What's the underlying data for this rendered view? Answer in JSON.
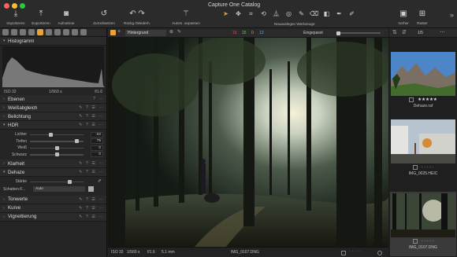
{
  "app": {
    "title": "Capture One Catalog"
  },
  "toolbar": {
    "import": "Importieren",
    "export": "Exportieren",
    "capture": "Aufnahme",
    "reset": "Zurücksetzen",
    "undo_redo": "Rückg./Wiederh.",
    "auto_adjust": "Autom. anpassen",
    "cursor_tools": "Neuauslegen Werkzeuge",
    "viewer": "Vorher",
    "grid": "Raster"
  },
  "histogram": {
    "title": "Histogramm",
    "iso": "ISO 32",
    "shutter": "1/560 s",
    "aperture": "f/1.6"
  },
  "tools": {
    "layers": "Ebenen",
    "white_balance": "Weißabgleich",
    "exposure": "Belichtung",
    "hdr": {
      "title": "HDR",
      "sliders": [
        {
          "label": "Lichter",
          "value": "-22",
          "pos": 0.39
        },
        {
          "label": "Tiefen",
          "value": "75",
          "pos": 0.87
        },
        {
          "label": "Weiß",
          "value": "0",
          "pos": 0.5
        },
        {
          "label": "Schwarz",
          "value": "0",
          "pos": 0.5
        }
      ]
    },
    "clarity": "Klarheit",
    "dehaze": {
      "title": "Dehaze",
      "strength_label": "Stärke",
      "strength_value": "",
      "shadow_label": "Schatten-F...",
      "shadow_value": "Auto"
    },
    "tone_curve": "Tonwerte",
    "curve": "Kurve",
    "vignette": "Vignettierung"
  },
  "viewer": {
    "layer": "Hintergrund",
    "counts": {
      "red": "15",
      "green": "15",
      "orange": "0",
      "blue": "13"
    },
    "fit": "Eingepasst",
    "bottom": {
      "iso": "ISO 32",
      "shutter": "1/560 s",
      "aperture": "f/1.6",
      "focal": "5.1 mm",
      "filename": "IMG_0107.DNG"
    }
  },
  "browser": {
    "page": "1/5",
    "thumbs": [
      {
        "name": "Dehaze.raf",
        "stars": "★★★★★"
      },
      {
        "name": "IMG_0025.HEIC",
        "stars": "· · · · ·"
      },
      {
        "name": "IMG_0107.DNG",
        "stars": "· · · · ·"
      }
    ]
  },
  "colors": {
    "accent": "#e8a33a",
    "panel": "#252525",
    "background": "#1b1b1b"
  }
}
